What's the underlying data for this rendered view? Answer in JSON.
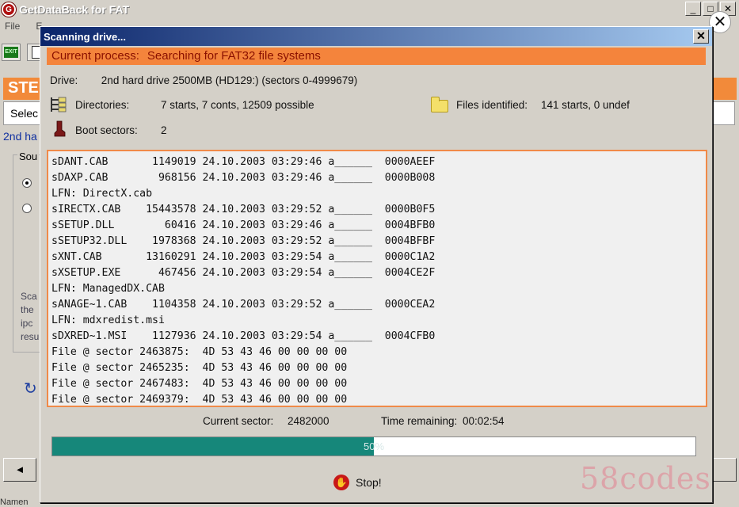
{
  "main_window": {
    "title": "GetDataBack for FAT",
    "app_icon_glyph": "G",
    "window_buttons": [
      "_",
      "□",
      "✕"
    ],
    "close_glyph": "✕",
    "menu": [
      "File",
      "E"
    ],
    "toolbar": {
      "exit_label": "EXIT"
    },
    "step_banner": "STE",
    "select_text": "Selec",
    "drive_link": "2nd ha",
    "group_label": "Sou",
    "help_text": [
      "Sca",
      "the",
      "ipc",
      "resu"
    ],
    "bottom_left_glyph": "◄",
    "status_label": "Namen"
  },
  "dialog": {
    "title": "Scanning drive...",
    "close_glyph": "✕",
    "current_process_label": "Current process:",
    "current_process_value": "Searching for FAT32 file systems",
    "drive_label": "Drive:",
    "drive_value": "2nd hard drive 2500MB (HD129:) (sectors 0-4999679)",
    "directories_label": "Directories:",
    "directories_value": "7 starts, 7 conts, 12509 possible",
    "files_label": "Files identified:",
    "files_value": "141 starts, 0 undef",
    "boot_label": "Boot sectors:",
    "boot_value": "2",
    "log_lines": [
      "sDANT.CAB       1149019 24.10.2003 03:29:46 a______  0000AEEF",
      "sDAXP.CAB        968156 24.10.2003 03:29:46 a______  0000B008",
      "LFN: DirectX.cab",
      "sIRECTX.CAB    15443578 24.10.2003 03:29:52 a______  0000B0F5",
      "sSETUP.DLL        60416 24.10.2003 03:29:46 a______  0004BFB0",
      "sSETUP32.DLL    1978368 24.10.2003 03:29:52 a______  0004BFBF",
      "sXNT.CAB       13160291 24.10.2003 03:29:54 a______  0000C1A2",
      "sXSETUP.EXE      467456 24.10.2003 03:29:54 a______  0004CE2F",
      "LFN: ManagedDX.CAB",
      "sANAGE~1.CAB    1104358 24.10.2003 03:29:52 a______  0000CEA2",
      "LFN: mdxredist.msi",
      "sDXRED~1.MSI    1127936 24.10.2003 03:29:54 a______  0004CFB0",
      "File @ sector 2463875:  4D 53 43 46 00 00 00 00",
      "File @ sector 2465235:  4D 53 43 46 00 00 00 00",
      "File @ sector 2467483:  4D 53 43 46 00 00 00 00",
      "File @ sector 2469379:  4D 53 43 46 00 00 00 00"
    ],
    "current_sector_label": "Current sector:",
    "current_sector_value": "2482000",
    "time_remaining_label": "Time remaining:",
    "time_remaining_value": "00:02:54",
    "progress_percent": 50,
    "progress_text": "50%",
    "stop_label": "Stop!"
  },
  "watermark": "58codes",
  "colors": {
    "process_bar": "#f4843c",
    "log_border": "#f08a48",
    "progress_fill": "#16877a",
    "title_gradient_start": "#0a246a"
  }
}
